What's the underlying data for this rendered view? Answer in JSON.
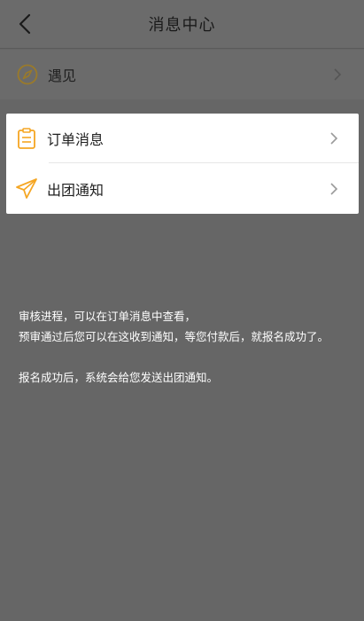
{
  "header": {
    "title": "消息中心"
  },
  "menu": [
    {
      "label": "遇见",
      "icon": "compass-icon"
    },
    {
      "label": "订单消息",
      "icon": "clipboard-icon"
    },
    {
      "label": "出团通知",
      "icon": "send-icon"
    }
  ],
  "info": {
    "line1": "审核进程，可以在订单消息中查看，",
    "line2": "预审通过后您可以在这收到通知，等您付款后，就报名成功了。",
    "line3": "报名成功后，系统会给您发送出团通知。"
  },
  "colors": {
    "accent": "#f5a623",
    "overlay": "#666666",
    "text": "#1f1f1f"
  }
}
